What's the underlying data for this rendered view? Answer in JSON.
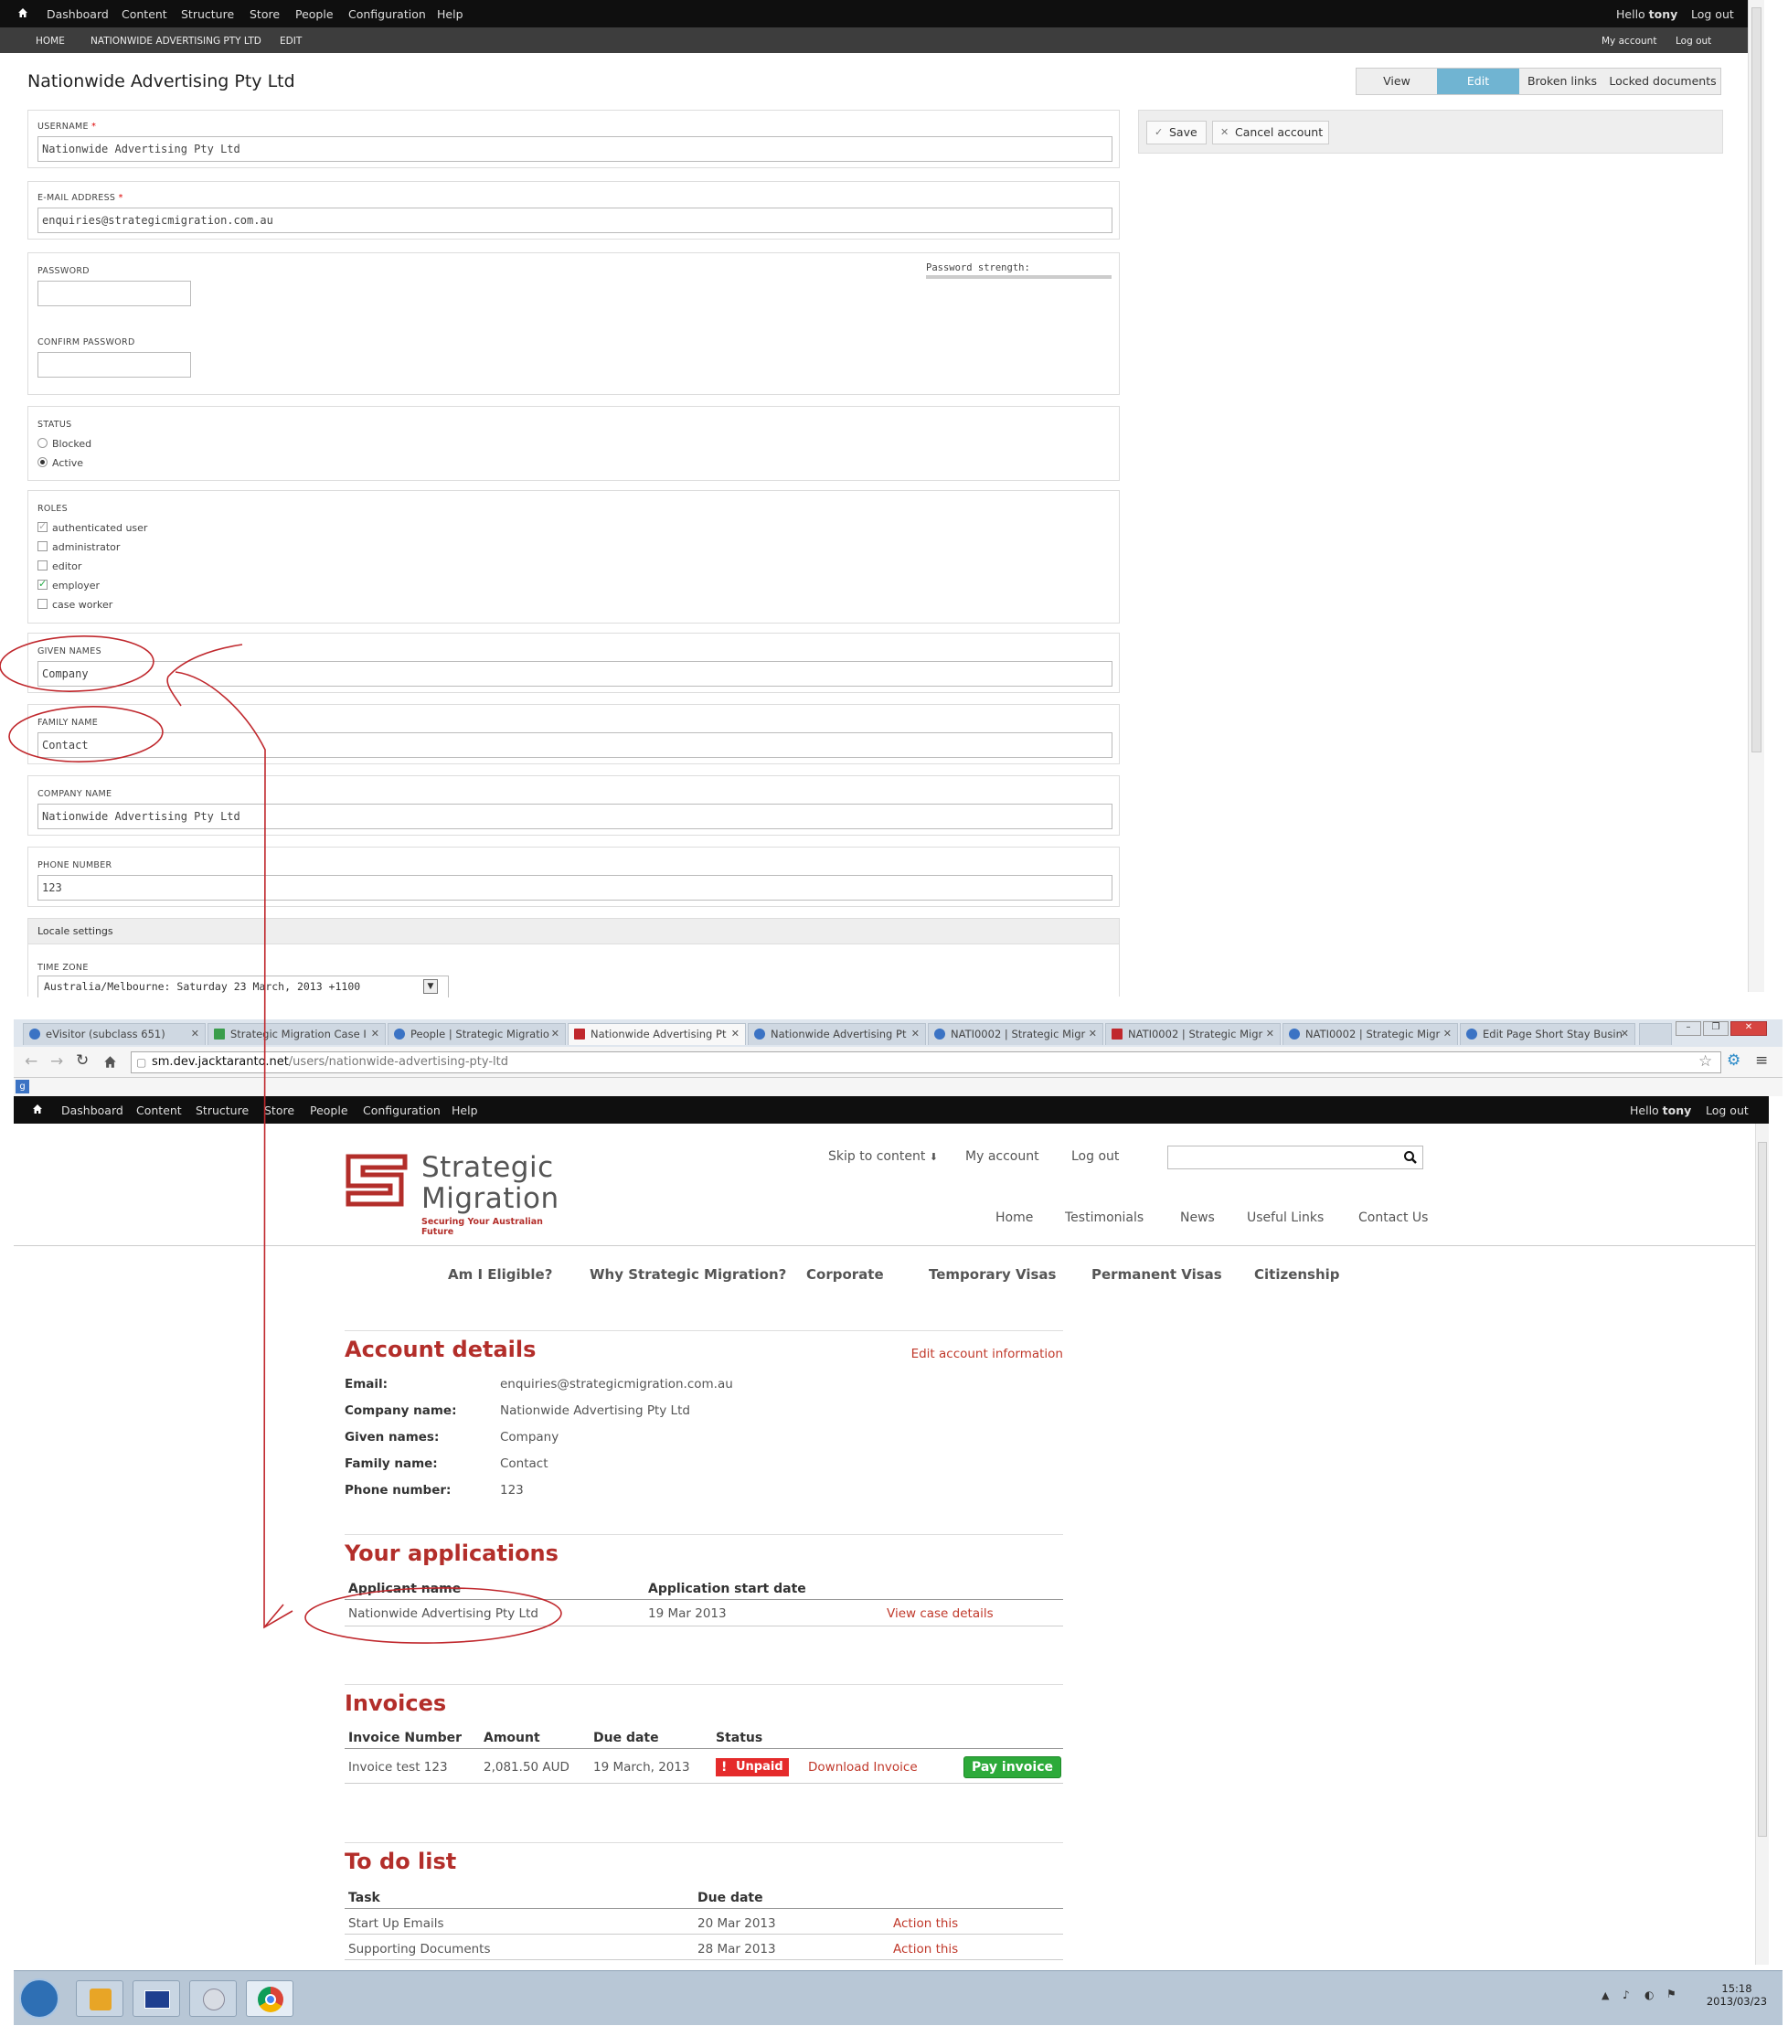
{
  "admin": {
    "toolbar": {
      "items": [
        "Dashboard",
        "Content",
        "Structure",
        "Store",
        "People",
        "Configuration",
        "Help"
      ],
      "hello": "Hello",
      "user": "tony",
      "logout": "Log out"
    },
    "breadcrumb": {
      "items": [
        "HOME",
        "NATIONWIDE ADVERTISING PTY LTD",
        "EDIT"
      ],
      "my_account": "My account",
      "logout": "Log out"
    },
    "page_title": "Nationwide Advertising Pty Ltd",
    "tabs": [
      "View",
      "Edit",
      "Broken links",
      "Locked documents"
    ],
    "actions": {
      "save": "Save",
      "cancel": "Cancel account"
    },
    "username": {
      "label": "USERNAME",
      "value": "Nationwide Advertising Pty Ltd"
    },
    "email": {
      "label": "E-MAIL ADDRESS",
      "value": "enquiries@strategicmigration.com.au"
    },
    "required_mark": "*",
    "password": {
      "label": "PASSWORD",
      "confirm_label": "CONFIRM PASSWORD",
      "strength_label": "Password strength:"
    },
    "status": {
      "label": "STATUS",
      "options": [
        "Blocked",
        "Active"
      ],
      "selected": "Active"
    },
    "roles": {
      "label": "ROLES",
      "options": [
        "authenticated user",
        "administrator",
        "editor",
        "employer",
        "case worker"
      ]
    },
    "given_names": {
      "label": "GIVEN NAMES",
      "value": "Company"
    },
    "family_name": {
      "label": "FAMILY NAME",
      "value": "Contact"
    },
    "company_name": {
      "label": "COMPANY NAME",
      "value": "Nationwide Advertising Pty Ltd"
    },
    "phone": {
      "label": "PHONE NUMBER",
      "value": "123"
    },
    "locale": {
      "title": "Locale settings",
      "tz_label": "TIME ZONE",
      "tz_value": "Australia/Melbourne: Saturday 23 March, 2013 +1100"
    }
  },
  "browser": {
    "tabs": [
      "eVisitor (subclass 651)",
      "Strategic Migration Case I",
      "People | Strategic Migratio",
      "Nationwide Advertising Pt",
      "Nationwide Advertising Pt",
      "NATI0002 | Strategic Migr",
      "NATI0002 | Strategic Migr",
      "NATI0002 | Strategic Migr",
      "Edit Page Short Stay Busin"
    ],
    "url_host": "sm.dev.jacktaranto.net",
    "url_path": "/users/nationwide-advertising-pty-ltd",
    "bookmark_icon": "google-bookmark-icon"
  },
  "site": {
    "toolbar": {
      "items": [
        "Dashboard",
        "Content",
        "Structure",
        "Store",
        "People",
        "Configuration",
        "Help"
      ],
      "hello": "Hello",
      "user": "tony",
      "logout": "Log out"
    },
    "logo": {
      "line1": "Strategic",
      "line2": "Migration",
      "tagline": "Securing Your Australian Future"
    },
    "top_links": [
      "Skip to content",
      "My account",
      "Log out"
    ],
    "nav": [
      "Home",
      "Testimonials",
      "News",
      "Useful Links",
      "Contact Us"
    ],
    "main_nav": [
      "Am I Eligible?",
      "Why Strategic Migration?",
      "Corporate",
      "Temporary Visas",
      "Permanent Visas",
      "Citizenship"
    ],
    "account": {
      "title": "Account details",
      "edit_link": "Edit account information",
      "rows": [
        {
          "k": "Email:",
          "v": "enquiries@strategicmigration.com.au"
        },
        {
          "k": "Company name:",
          "v": "Nationwide Advertising Pty Ltd"
        },
        {
          "k": "Given names:",
          "v": "Company"
        },
        {
          "k": "Family name:",
          "v": "Contact"
        },
        {
          "k": "Phone number:",
          "v": "123"
        }
      ]
    },
    "applications": {
      "title": "Your applications",
      "headers": [
        "Applicant name",
        "Application start date"
      ],
      "rows": [
        {
          "name": "Nationwide Advertising Pty Ltd",
          "date": "19 Mar 2013",
          "link": "View case details"
        }
      ]
    },
    "invoices": {
      "title": "Invoices",
      "headers": [
        "Invoice Number",
        "Amount",
        "Due date",
        "Status"
      ],
      "rows": [
        {
          "number": "Invoice test 123",
          "amount": "2,081.50 AUD",
          "due": "19 March, 2013",
          "status": "Unpaid",
          "download": "Download Invoice",
          "pay": "Pay invoice"
        }
      ]
    },
    "todo": {
      "title": "To do list",
      "headers": [
        "Task",
        "Due date"
      ],
      "rows": [
        {
          "task": "Start Up Emails",
          "due": "20 Mar 2013",
          "link": "Action this"
        },
        {
          "task": "Supporting Documents",
          "due": "28 Mar 2013",
          "link": "Action this"
        }
      ]
    }
  },
  "taskbar": {
    "time": "15:18",
    "date": "2013/03/23"
  },
  "colors": {
    "accent_red": "#b32e2a",
    "link_red": "#c0392b",
    "edit_tab_blue": "#70b4d2",
    "pay_green": "#2daa3a",
    "unpaid_red": "#e52b2b",
    "annotation": "#c0282d"
  }
}
